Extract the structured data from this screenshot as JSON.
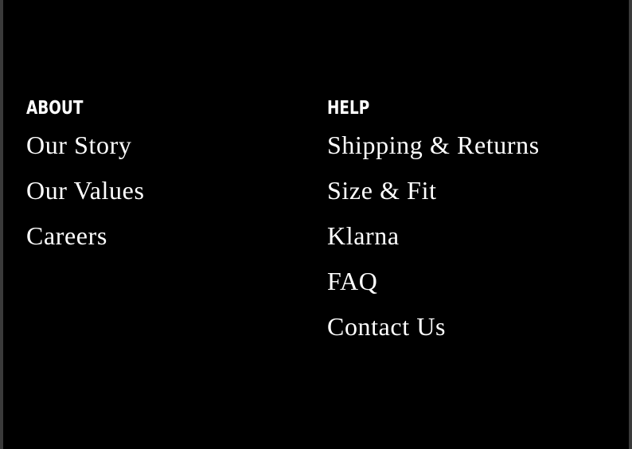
{
  "footer": {
    "about": {
      "title": "ABOUT",
      "links": [
        "Our Story",
        "Our Values",
        "Careers"
      ]
    },
    "help": {
      "title": "HELP",
      "links": [
        "Shipping & Returns",
        "Size & Fit",
        "Klarna",
        "FAQ",
        "Contact Us"
      ]
    }
  },
  "colors": {
    "background": "#000000",
    "text": "#ffffff"
  }
}
